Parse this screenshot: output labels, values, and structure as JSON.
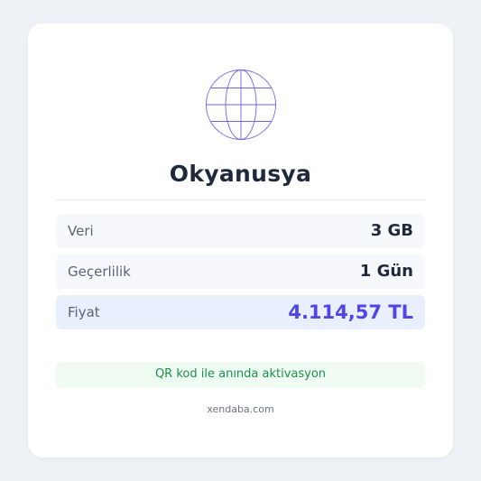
{
  "card": {
    "icon": "globe-icon",
    "title": "Okyanusya",
    "rows": [
      {
        "label": "Veri",
        "value": "3 GB"
      },
      {
        "label": "Geçerlilik",
        "value": "1 Gün"
      },
      {
        "label": "Fiyat",
        "value": "4.114,57 TL"
      }
    ],
    "activation_note": "QR kod ile anında aktivasyon",
    "footer_domain": "xendaba.com"
  },
  "colors": {
    "page_background": "#eef1f6",
    "card_background": "#ffffff",
    "title_text": "#1e293b",
    "price_accent": "#4f46e5",
    "price_row_background": "#eaeffd",
    "activation_text": "#17924a",
    "activation_background": "#f0fbf3",
    "globe_stroke": "#6d63e8"
  }
}
